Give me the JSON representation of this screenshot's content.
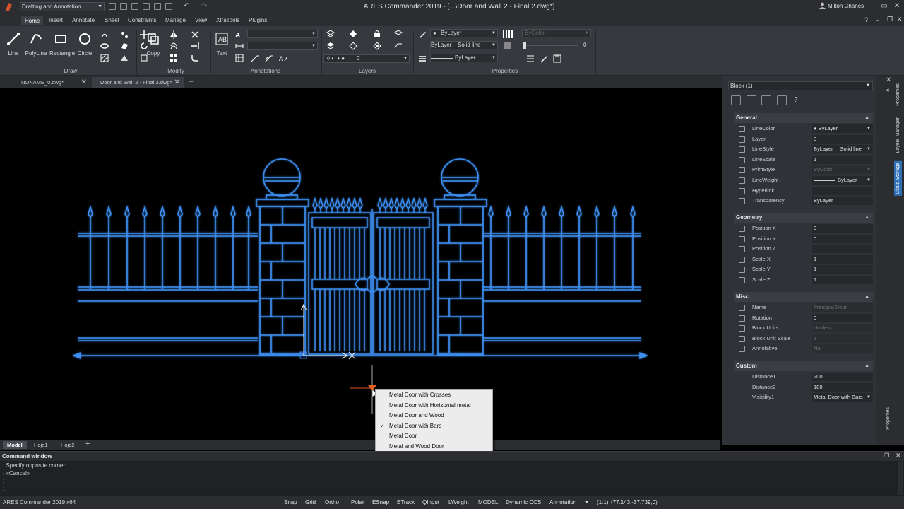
{
  "app": {
    "workspace": "Drafting and Annotation",
    "title": "ARES Commander 2019 - [...\\Door and Wall 2 - Final 2.dwg*]",
    "user": "Milton Chanes",
    "help": "?"
  },
  "ribbon_tabs": [
    "Home",
    "Insert",
    "Annotate",
    "Sheet",
    "Constraints",
    "Manage",
    "View",
    "XtraTools",
    "Plugins"
  ],
  "ribbon": {
    "draw": {
      "title": "Draw",
      "tools": [
        "Line",
        "PolyLine",
        "Rectangle",
        "Circle"
      ]
    },
    "modify": {
      "title": "Modify",
      "tools": [
        "Copy"
      ]
    },
    "annotations": {
      "title": "Annotations",
      "tools": [
        "Text"
      ]
    },
    "layers": {
      "title": "Layers",
      "layer_value": "0"
    },
    "properties": {
      "title": "Properties",
      "color": "ByLayer",
      "linestyle_layer": "ByLayer",
      "linestyle": "Solid line",
      "lineweight": "ByLayer",
      "print_style": "ByColor",
      "transparency": "0"
    }
  },
  "doc_tabs": [
    {
      "label": "NONAME_0.dwg*",
      "active": false
    },
    {
      "label": "Door and Wall 2 - Final 2.dwg*",
      "active": true
    }
  ],
  "layout_tabs": [
    "Model",
    "Hoja1",
    "Hoja2"
  ],
  "properties_panel": {
    "selection": "Block (1)",
    "sections": {
      "general": {
        "title": "General",
        "rows": [
          {
            "name": "LineColor",
            "value": "ByLayer"
          },
          {
            "name": "Layer",
            "value": "0"
          },
          {
            "name": "LineStyle",
            "value": "ByLayer",
            "value2": "Solid line"
          },
          {
            "name": "LineScale",
            "value": "1"
          },
          {
            "name": "PrintStyle",
            "value": "ByColor"
          },
          {
            "name": "LineWeight",
            "value": "ByLayer"
          },
          {
            "name": "Hyperlink",
            "value": ""
          },
          {
            "name": "Transparency",
            "value": "ByLayer"
          }
        ]
      },
      "geometry": {
        "title": "Geometry",
        "rows": [
          {
            "name": "Position X",
            "value": "0"
          },
          {
            "name": "Position Y",
            "value": "0"
          },
          {
            "name": "Position Z",
            "value": "0"
          },
          {
            "name": "Scale X",
            "value": "1"
          },
          {
            "name": "Scale Y",
            "value": "1"
          },
          {
            "name": "Scale Z",
            "value": "1"
          }
        ]
      },
      "misc": {
        "title": "Misc",
        "rows": [
          {
            "name": "Name",
            "value": "Principal Door"
          },
          {
            "name": "Rotation",
            "value": "0"
          },
          {
            "name": "Block Units",
            "value": "Unitless"
          },
          {
            "name": "Block Unit Scale",
            "value": "1"
          },
          {
            "name": "Annotative",
            "value": "No"
          }
        ]
      },
      "custom": {
        "title": "Custom",
        "rows": [
          {
            "name": "Distance1",
            "value": "200"
          },
          {
            "name": "Distance2",
            "value": "180"
          },
          {
            "name": "Visibility1",
            "value": "Metal Door with Bars"
          }
        ]
      }
    }
  },
  "side_tabs": [
    "Properties",
    "Layers Manager",
    "Cloud Storage",
    "Properties"
  ],
  "popup_menu": {
    "items": [
      {
        "label": "Metal Door with Crosses",
        "checked": false
      },
      {
        "label": "Metal Door with Horizontal metal",
        "checked": false
      },
      {
        "label": "Metal Door and Wood",
        "checked": false
      },
      {
        "label": "Metal Door with Bars",
        "checked": true
      },
      {
        "label": "Metal Door",
        "checked": false
      },
      {
        "label": "Metal and Wood Door",
        "checked": false
      }
    ],
    "check_mark": "✓"
  },
  "command_window": {
    "title": "Command window",
    "lines": [
      ": Specify opposite corner:",
      ": «Cancel»",
      ":",
      ":"
    ]
  },
  "status_bar": {
    "app_name": "ARES Commander 2019 x64",
    "toggles": [
      "Snap",
      "Grid",
      "Ortho",
      "Polar",
      "ESnap",
      "ETrack",
      "QInput",
      "LWeight",
      "MODEL",
      "Dynamic CCS"
    ],
    "annotation": "Annotation",
    "scale": "(1:1)",
    "coords": "(77.143,-37.739,0)"
  },
  "colors": {
    "drawing": "#3d8ef0",
    "background": "#000000",
    "panel": "#2f3237",
    "cloud_tab": "#2f6fb6"
  }
}
